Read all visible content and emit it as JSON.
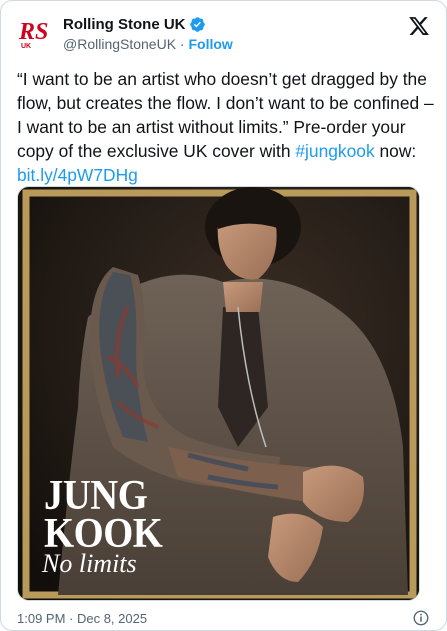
{
  "account": {
    "display_name": "Rolling Stone UK",
    "handle": "@RollingStoneUK",
    "separator": " · ",
    "follow_label": "Follow",
    "logo_text": "RS",
    "logo_sub": "UK"
  },
  "tweet": {
    "text_part1": "“I want to be an artist who doesn’t get dragged by the flow, but creates the flow. I don’t want to be confined – I want to be an artist without limits.” Pre-order your copy of the exclusive UK cover with ",
    "hashtag": "#jungkook",
    "text_part2": " now: ",
    "link": "bit.ly/4pW7DHg"
  },
  "media": {
    "cover_title_line1": "JUNG",
    "cover_title_line2": "KOOK",
    "cover_subtitle": "No limits",
    "frame_color": "#b89a5a",
    "background_color": "#1b1612"
  },
  "footer": {
    "timestamp": "1:09 PM · Dec 8, 2025"
  },
  "colors": {
    "accent": "#1d9bf0",
    "logo_red": "#d0021b",
    "muted": "#536471"
  },
  "icons": {
    "verified": "verified-badge-icon",
    "x": "x-logo-icon",
    "info": "info-icon"
  }
}
